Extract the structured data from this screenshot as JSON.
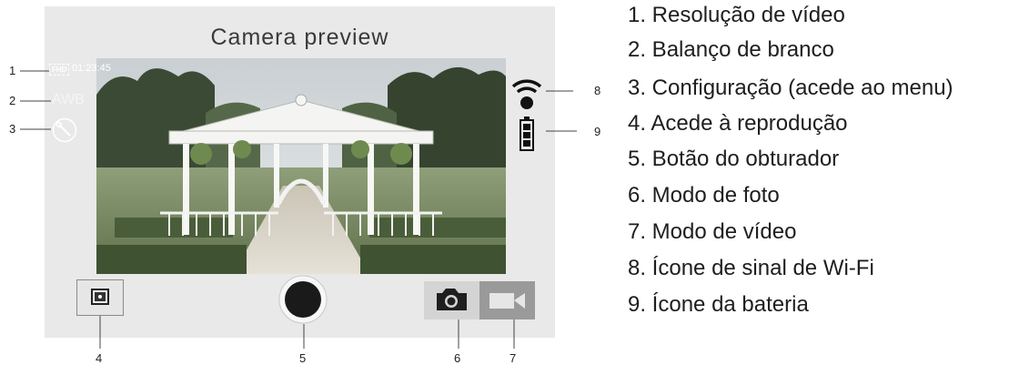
{
  "screen": {
    "title": "Camera preview",
    "video_quality_badge": "FHD",
    "recording_time": "01:23:45",
    "white_balance": "AWB",
    "icons": {
      "settings": "wrench-icon",
      "wifi": "wifi-icon",
      "battery": "battery-icon",
      "playback": "playback-icon",
      "shutter": "shutter-icon",
      "photo_mode": "camera-icon",
      "video_mode": "video-camera-icon"
    },
    "colors": {
      "screen_background": "#e9e9e9",
      "photo_mode_background": "#d4d4d4",
      "video_mode_background": "#9a9a9a",
      "shutter_fill": "#1a1a1a"
    }
  },
  "callouts": {
    "c1": "1",
    "c2": "2",
    "c3": "3",
    "c4": "4",
    "c5": "5",
    "c6": "6",
    "c7": "7",
    "c8": "8",
    "c9": "9"
  },
  "legend": [
    "1. Resolução de vídeo",
    "2. Balanço de branco",
    "3. Configuração (acede ao menu)",
    "4. Acede à reprodução",
    "5. Botão do obturador",
    "6. Modo de foto",
    "7. Modo de vídeo",
    "8. Ícone de sinal de Wi-Fi",
    "9. Ícone da bateria"
  ]
}
